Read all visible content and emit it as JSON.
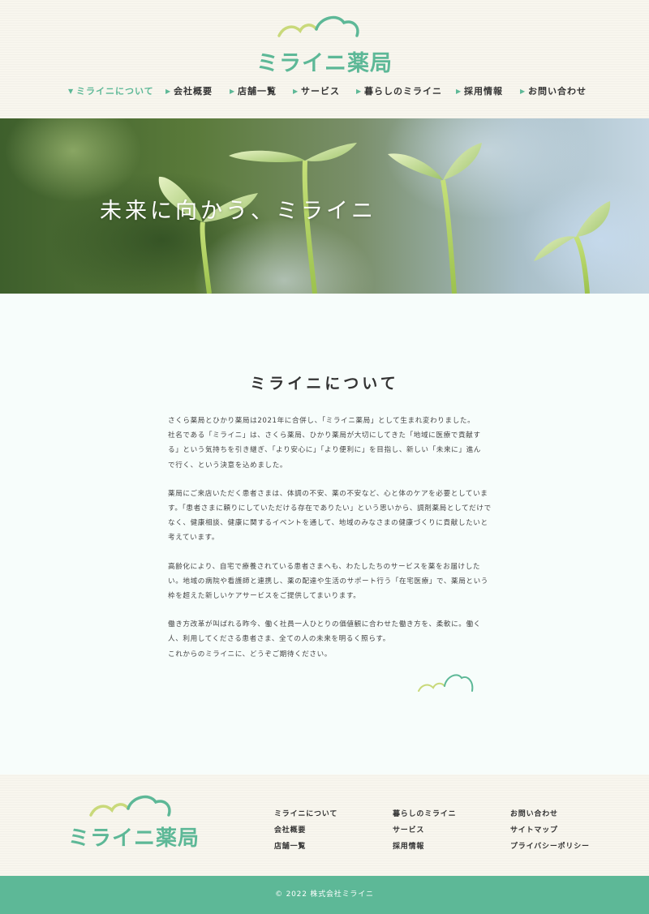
{
  "brand": {
    "name": "ミライニ薬局",
    "accent_color": "#5db897",
    "leaf_color": "#c9d97a"
  },
  "nav": {
    "items": [
      {
        "label": "ミライニについて",
        "active": true
      },
      {
        "label": "会社概要"
      },
      {
        "label": "店舗一覧"
      },
      {
        "label": "サービス"
      },
      {
        "label": "暮らしのミライニ"
      },
      {
        "label": "採用情報"
      },
      {
        "label": "お問い合わせ"
      }
    ]
  },
  "hero": {
    "title": "未来に向かう、ミライニ"
  },
  "about": {
    "title": "ミライニについて",
    "paragraphs": [
      [
        "さくら薬局とひかり薬局は2021年に合併し、「ミライニ薬局」として生まれ変わりました。",
        "社名である「ミライニ」は、さくら薬局、ひかり薬局が大切にしてきた「地域に医療で貢献す",
        "る」という気持ちを引き継ぎ、「より安心に」「より便利に」を目指し、新しい「未来に」進ん",
        "で行く、という決意を込めました。"
      ],
      [
        "薬局にご来店いただく患者さまは、体調の不安、薬の不安など、心と体のケアを必要としていま",
        "す。「患者さまに頼りにしていただける存在でありたい」という思いから、調剤薬局としてだけで",
        "なく、健康相談、健康に関するイベントを通して、地域のみなさまの健康づくりに貢献したいと",
        "考えています。"
      ],
      [
        "高齢化により、自宅で療養されている患者さまへも、わたしたちのサービスを薬をお届けした",
        "い。地域の病院や看護師と連携し、薬の配達や生活のサポート行う「在宅医療」で、薬局という",
        "枠を超えた新しいケアサービスをご提供してまいります。"
      ],
      [
        "働き方改革が叫ばれる昨今、働く社員一人ひとりの価値観に合わせた働き方を、柔軟に。働く",
        "人、利用してくださる患者さま、全ての人の未来を明るく照らす。",
        "これからのミライニに、どうぞご期待ください。"
      ]
    ]
  },
  "footer": {
    "links": [
      [
        "ミライニについて",
        "会社概要",
        "店舗一覧"
      ],
      [
        "暮らしのミライニ",
        "サービス",
        "採用情報"
      ],
      [
        "お問い合わせ",
        "サイトマップ",
        "プライバシーポリシー"
      ]
    ],
    "copyright": "© 2022 株式会社ミライニ"
  }
}
